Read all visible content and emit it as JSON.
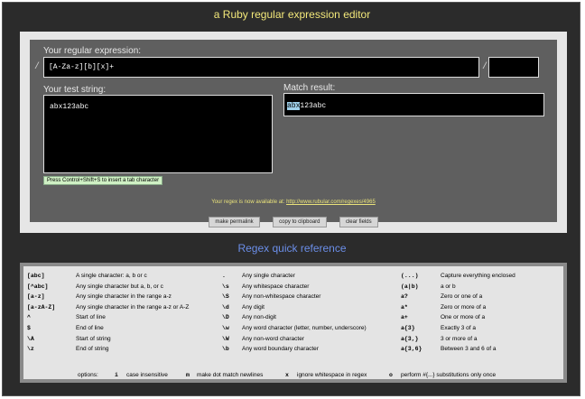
{
  "page_title": "a Ruby regular expression editor",
  "editor": {
    "regex_label": "Your regular expression:",
    "slash": "/",
    "regex_value": "[A-Za-z][b][x]+",
    "options_value": "",
    "test_label": "Your test string:",
    "test_value": "abx123abc",
    "result_label": "Match result:",
    "result_match": "abx",
    "result_rest": "123abc",
    "hint": "Press Control+Shift+S to insert a tab character",
    "available_text": "Your regex is now available at:",
    "permalink_url": "http://www.rubular.com/regexes/4965",
    "buttons": {
      "permalink": "make permalink",
      "clipboard": "copy to clipboard",
      "clear": "clear fields"
    }
  },
  "quick_ref": {
    "title": "Regex quick reference",
    "col1": [
      {
        "code": "[abc]",
        "desc": "A single character: a, b or c"
      },
      {
        "code": "[^abc]",
        "desc": "Any single character but a, b, or c"
      },
      {
        "code": "[a-z]",
        "desc": "Any single character in the range a-z"
      },
      {
        "code": "[a-zA-Z]",
        "desc": "Any single character in the range a-z or A-Z"
      },
      {
        "code": "^",
        "desc": "Start of line"
      },
      {
        "code": "$",
        "desc": "End of line"
      },
      {
        "code": "\\A",
        "desc": "Start of string"
      },
      {
        "code": "\\z",
        "desc": "End of string"
      }
    ],
    "col2": [
      {
        "code": ".",
        "desc": "Any single character"
      },
      {
        "code": "\\s",
        "desc": "Any whitespace character"
      },
      {
        "code": "\\S",
        "desc": "Any non-whitespace character"
      },
      {
        "code": "\\d",
        "desc": "Any digit"
      },
      {
        "code": "\\D",
        "desc": "Any non-digit"
      },
      {
        "code": "\\w",
        "desc": "Any word character (letter, number, underscore)"
      },
      {
        "code": "\\W",
        "desc": "Any non-word character"
      },
      {
        "code": "\\b",
        "desc": "Any word boundary character"
      }
    ],
    "col3": [
      {
        "code": "(...)",
        "desc": "Capture everything enclosed"
      },
      {
        "code": "(a|b)",
        "desc": "a or b"
      },
      {
        "code": "a?",
        "desc": "Zero or one of a"
      },
      {
        "code": "a*",
        "desc": "Zero or more of a"
      },
      {
        "code": "a+",
        "desc": "One or more of a"
      },
      {
        "code": "a{3}",
        "desc": "Exactly 3 of a"
      },
      {
        "code": "a{3,}",
        "desc": "3 or more of a"
      },
      {
        "code": "a{3,6}",
        "desc": "Between 3 and 6 of a"
      }
    ],
    "options": {
      "label": "options:",
      "items": [
        {
          "code": "i",
          "desc": "case insensitive"
        },
        {
          "code": "m",
          "desc": "make dot match newlines"
        },
        {
          "code": "x",
          "desc": "ignore whitespace in regex"
        },
        {
          "code": "o",
          "desc": "perform #{...} substitutions only once"
        }
      ]
    }
  }
}
